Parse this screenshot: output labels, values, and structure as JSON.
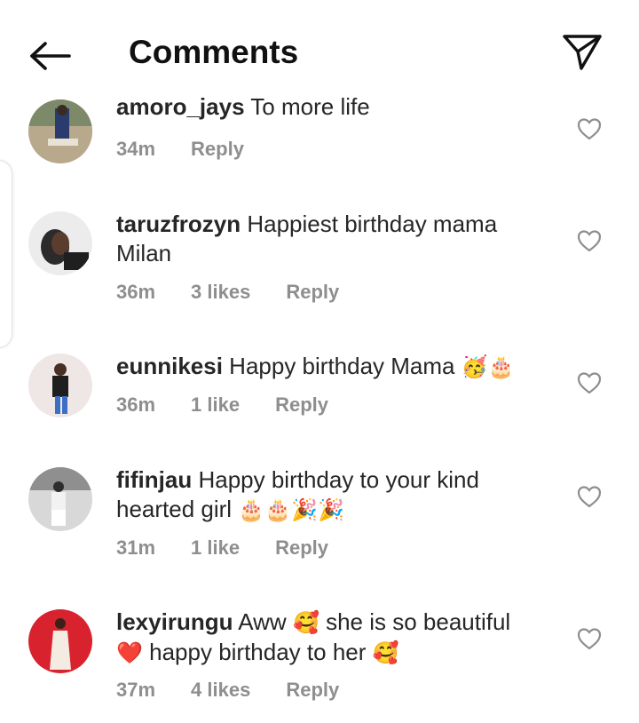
{
  "header": {
    "title": "Comments",
    "back_icon": "arrow-left-icon",
    "share_icon": "paper-plane-icon"
  },
  "comments": [
    {
      "username": "amoro_jays",
      "text": "To more life",
      "emojis": "",
      "time": "34m",
      "likes": "",
      "reply": "Reply"
    },
    {
      "username": "taruzfrozyn",
      "text": "Happiest birthday mama Milan",
      "emojis": "",
      "time": "36m",
      "likes": "3 likes",
      "reply": "Reply"
    },
    {
      "username": "eunnikesi",
      "text": "Happy birthday Mama",
      "emojis": "🥳🎂",
      "time": "36m",
      "likes": "1 like",
      "reply": "Reply"
    },
    {
      "username": "fifinjau",
      "text": "Happy birthday to your kind hearted girl",
      "emojis": "🎂🎂🎉🎉",
      "time": "31m",
      "likes": "1 like",
      "reply": "Reply"
    },
    {
      "username": "lexyirungu",
      "text": "Aww",
      "emojis": "🥰",
      "text2": "she is so beautiful",
      "emojis2": "❤️",
      "text3": "happy birthday to her",
      "emojis3": "🥰",
      "time": "37m",
      "likes": "4 likes",
      "reply": "Reply"
    }
  ],
  "colors": {
    "text": "#262626",
    "meta": "#8e8e8e",
    "heart": "#8e8e8e"
  }
}
